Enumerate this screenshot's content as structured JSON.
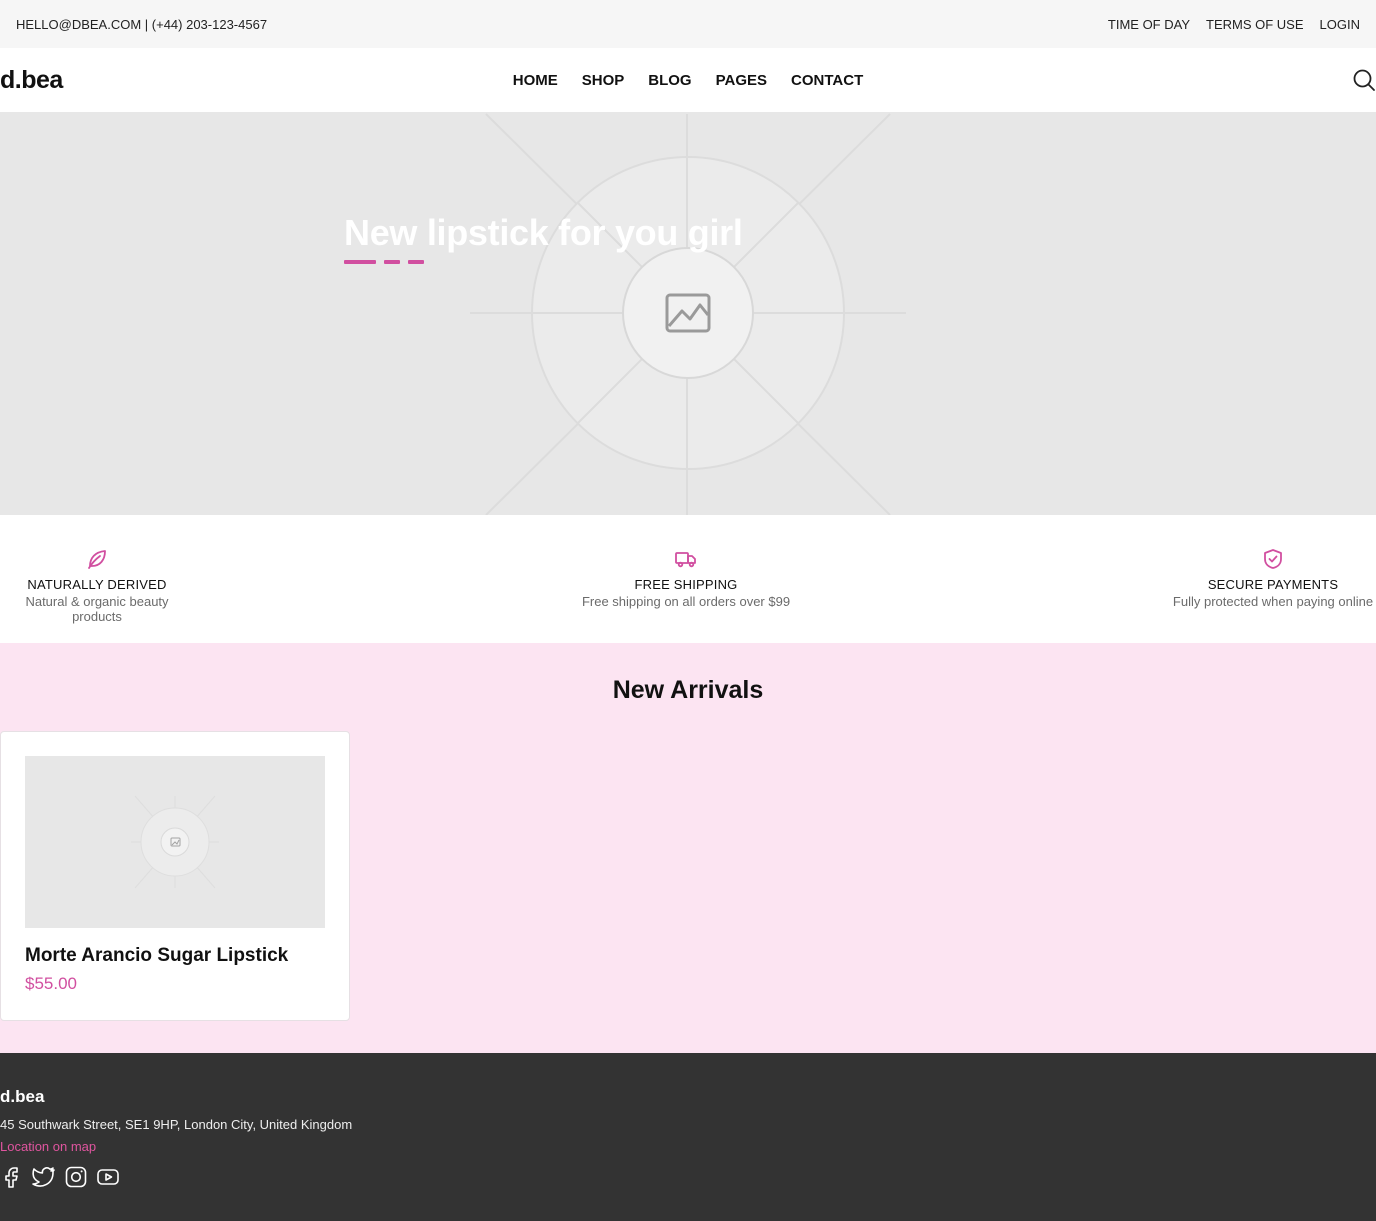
{
  "topbar": {
    "contact": "HELLO@DBEA.COM | (+44) 203-123-4567",
    "links": [
      "TIME OF DAY",
      "TERMS OF USE",
      "LOGIN"
    ]
  },
  "header": {
    "logo": "d.bea",
    "nav": [
      "HOME",
      "SHOP",
      "BLOG",
      "PAGES",
      "CONTACT"
    ],
    "search_icon": "search-icon"
  },
  "hero": {
    "title": "New lipstick for you girl",
    "slides": 3,
    "active_slide": 1,
    "image_icon": "image-placeholder-icon"
  },
  "features": [
    {
      "icon": "leaf-icon",
      "title": "NATURALLY DERIVED",
      "desc": "Natural & organic beauty products"
    },
    {
      "icon": "truck-icon",
      "title": "FREE SHIPPING",
      "desc": "Free shipping on all orders over $99"
    },
    {
      "icon": "shield-check-icon",
      "title": "SECURE PAYMENTS",
      "desc": "Fully protected when paying online"
    }
  ],
  "arrivals": {
    "heading": "New Arrivals",
    "products": [
      {
        "name": "Morte Arancio Sugar Lipstick",
        "price": "$55.00"
      }
    ]
  },
  "footer": {
    "logo": "d.bea",
    "address": "45 Southwark Street, SE1 9HP, London City, United Kingdom",
    "map_link": "Location on map",
    "social": [
      "facebook-icon",
      "twitter-icon",
      "instagram-icon",
      "youtube-icon"
    ]
  },
  "colors": {
    "accent": "#d14fa0",
    "arrivals_bg": "#fce4f2",
    "footer_bg": "#333333",
    "topbar_bg": "#f6f6f6",
    "placeholder_bg": "#e7e7e7"
  }
}
